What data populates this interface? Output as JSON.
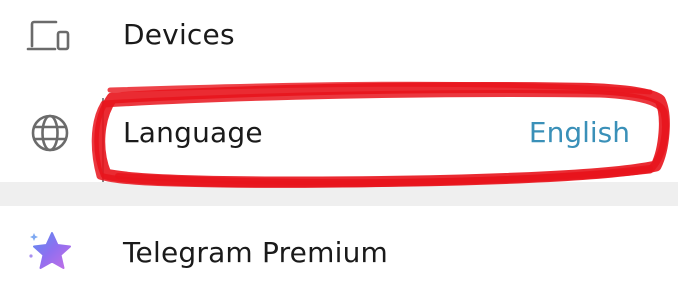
{
  "settings": {
    "devices": {
      "label": "Devices",
      "icon": "devices-icon"
    },
    "language": {
      "label": "Language",
      "value": "English",
      "icon": "globe-icon",
      "value_color": "#3a90b8"
    },
    "premium": {
      "label": "Telegram Premium",
      "icon": "premium-star-icon"
    }
  },
  "annotation": {
    "type": "red freehand highlight around Language row",
    "color": "#e8141c"
  }
}
